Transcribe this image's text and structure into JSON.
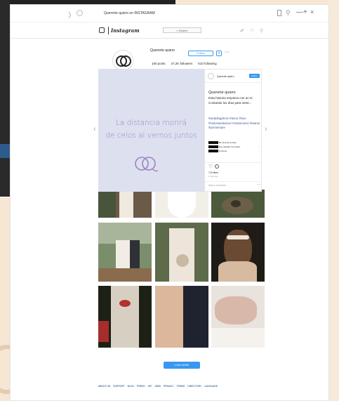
{
  "window": {
    "title": "Quererte quiero on INSTAGRAM",
    "back_glyph": "〉",
    "min_glyph": "—",
    "max_glyph": "+",
    "close_glyph": "×"
  },
  "igbar": {
    "logo_text": "Instagram",
    "search_placeholder": "⌕ Search",
    "icons": [
      "compass-icon",
      "heart-icon",
      "person-icon"
    ]
  },
  "profile": {
    "username": "Quererte quiero",
    "follow_label": "Follow",
    "dropdown_glyph": "▾",
    "more_glyph": "···",
    "posts": "150 posts",
    "followers": "47,2K followers",
    "following": "510 following"
  },
  "post": {
    "line1": "La distancia morirá",
    "line2": "de celos al vernos juntos",
    "prev_glyph": "‹",
    "next_glyph": "›",
    "side": {
      "username": "Quererte quiero",
      "follow_label": "Follow",
      "caption_title": "Quererte quiero",
      "caption_line1": "Esta historia empieza con un sí.",
      "caption_line2": "Contando los días para verte...",
      "hashtags": "#weddingdress #amor #love #historiasdeamor #matrimonio #teamo #porsiempre",
      "comments": [
        {
          "user": "▇▇▇▇▇▇",
          "text": "Me fascina la frase"
        },
        {
          "user": "▇▇▇▇▇▇",
          "text": "Que detalles tan lindos"
        },
        {
          "user": "▇▇▇▇▇▇",
          "text": "Inspiring"
        }
      ],
      "like_glyph": "♡",
      "likes": "710 likes",
      "date": "1 Day ago",
      "add_comment": "Add a comment...",
      "more_glyph": "···"
    }
  },
  "load_more_label": "LOAD MORE",
  "footer": [
    "ABOUT US",
    "SUPPORT",
    "BLOG",
    "PRESS",
    "API",
    "JOBS",
    "PRIVACY",
    "TERMS",
    "DIRECTORY",
    "LANGUAGE"
  ]
}
